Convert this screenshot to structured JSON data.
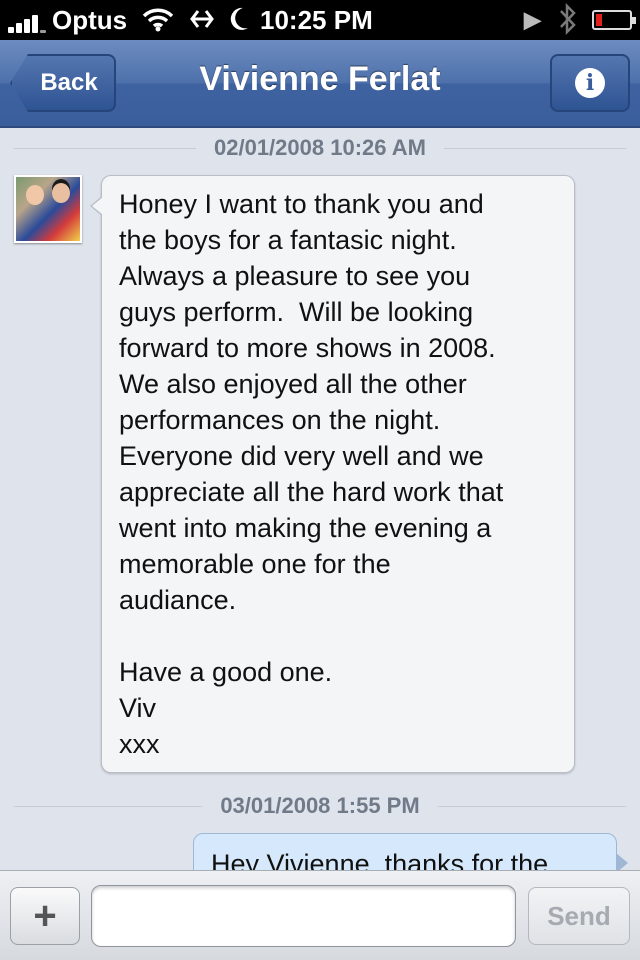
{
  "status_bar": {
    "carrier": "Optus",
    "time": "10:25 PM",
    "icons": [
      "signal-icon",
      "wifi-icon",
      "sync-icon",
      "moon-icon",
      "play-icon",
      "bluetooth-icon",
      "battery-icon"
    ],
    "battery_level": 0.1
  },
  "nav": {
    "back_label": "Back",
    "title": "Vivienne Ferlat",
    "info_icon": "info-icon"
  },
  "conversation": {
    "messages": [
      {
        "timestamp": "02/01/2008 10:26 AM",
        "direction": "received",
        "text": "Honey I want to thank you and\nthe boys for a fantasic night.\nAlways a pleasure to see you\nguys perform.  Will be looking\nforward to more shows in 2008.\nWe also enjoyed all the other\nperformances on the night.\nEveryone did very well and we\nappreciate all the hard work that\nwent into making the evening a\nmemorable one for the\naudiance.\n\nHave a good one.\nViv\nxxx"
      },
      {
        "timestamp": "03/01/2008 1:55 PM",
        "direction": "sent",
        "text": "Hey Vivienne, thanks for the"
      }
    ]
  },
  "compose": {
    "add_label": "+",
    "input_value": "",
    "send_label": "Send"
  },
  "colors": {
    "nav_blue": "#4e71ab",
    "background": "#dfe4ec",
    "sent_bubble": "#d6e8fb",
    "received_bubble": "#f4f5f7"
  }
}
